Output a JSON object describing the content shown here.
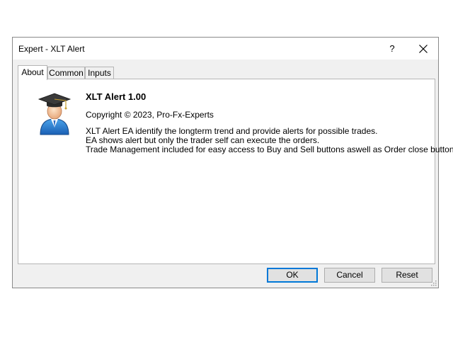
{
  "window": {
    "title": "Expert - XLT Alert",
    "help_label": "?"
  },
  "tabs": [
    {
      "label": "About",
      "active": true
    },
    {
      "label": "Common",
      "active": false
    },
    {
      "label": "Inputs",
      "active": false
    }
  ],
  "about": {
    "name": "XLT Alert 1.00",
    "copyright": "Copyright © 2023, Pro-Fx-Experts",
    "description": [
      "XLT Alert EA identify the longterm trend and provide alerts for possible trades.",
      "EA shows alert but only the trader self can execute the orders.",
      "Trade Management included for easy access to Buy and Sell buttons aswell as Order close button."
    ]
  },
  "buttons": {
    "ok": "OK",
    "cancel": "Cancel",
    "reset": "Reset"
  },
  "colors": {
    "focus_border": "#0078d7",
    "dialog_bg": "#f0f0f0",
    "panel_bg": "#ffffff"
  }
}
